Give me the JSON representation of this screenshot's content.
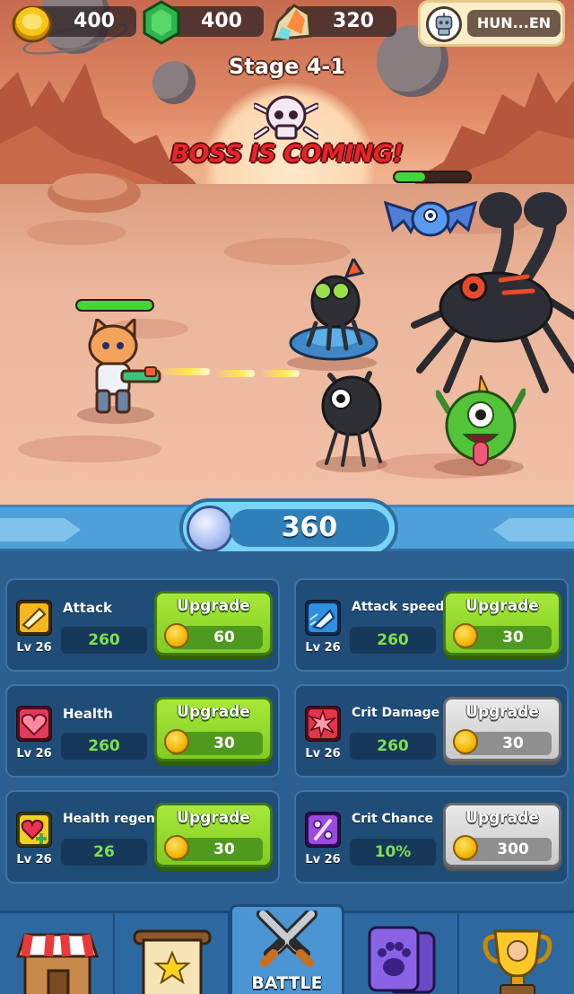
{
  "currency": {
    "coins": "400",
    "gems": "400",
    "crystals": "320"
  },
  "profile": {
    "name": "HUN...EN"
  },
  "battle": {
    "stage": "Stage 4-1",
    "banner": "BOSS IS COMING!",
    "player_hp": 1.0,
    "boss_hp": 0.4
  },
  "orb_counter": "360",
  "upgrades": [
    {
      "label": "Attack",
      "level": "Lv 26",
      "value": "260",
      "button": "Upgrade",
      "cost": "60",
      "enabled": true
    },
    {
      "label": "Attack speed",
      "level": "Lv 26",
      "value": "260",
      "button": "Upgrade",
      "cost": "30",
      "enabled": true
    },
    {
      "label": "Health",
      "level": "Lv 26",
      "value": "260",
      "button": "Upgrade",
      "cost": "30",
      "enabled": true
    },
    {
      "label": "Crit Damage",
      "level": "Lv 26",
      "value": "260",
      "button": "Upgrade",
      "cost": "30",
      "enabled": false
    },
    {
      "label": "Health regen",
      "level": "Lv 26",
      "value": "26",
      "button": "Upgrade",
      "cost": "30",
      "enabled": true
    },
    {
      "label": "Crit Chance",
      "level": "Lv 26",
      "value": "10%",
      "button": "Upgrade",
      "cost": "300",
      "enabled": false
    }
  ],
  "nav": {
    "active": "battle",
    "battle_label": "BATTLE",
    "items": [
      "shop-icon",
      "scroll-star-icon",
      "crossed-swords-icon",
      "paw-cards-icon",
      "trophy-icon"
    ]
  },
  "colors": {
    "upgrade_enabled": "#82cc22",
    "upgrade_disabled": "#c9c9c9",
    "stat_value": "#7fe04e",
    "boss_text": "#e8242b"
  }
}
